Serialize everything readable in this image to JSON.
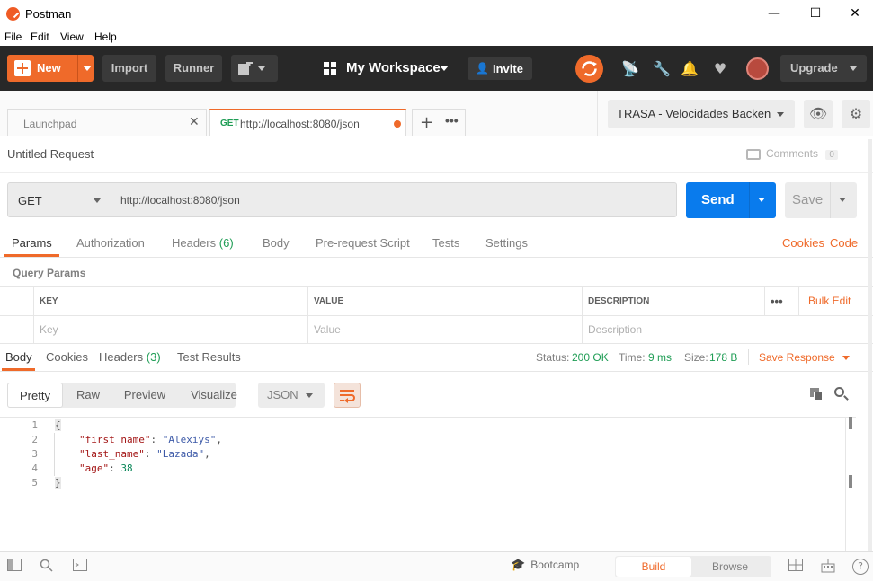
{
  "window": {
    "title": "Postman",
    "minimize": "—",
    "maximize": "☐",
    "close": "✕"
  },
  "menu": [
    "File",
    "Edit",
    "View",
    "Help"
  ],
  "header": {
    "new_label": "New",
    "import_label": "Import",
    "runner_label": "Runner",
    "workspace_label": "My Workspace",
    "invite_label": "Invite",
    "upgrade_label": "Upgrade",
    "accent_color": "#ef6a2a"
  },
  "tabs": [
    {
      "label": "Launchpad"
    },
    {
      "method": "GET",
      "label": "http://localhost:8080/json"
    }
  ],
  "environment": {
    "selected": "TRASA - Velocidades Backend"
  },
  "request": {
    "name": "Untitled Request",
    "comments_label": "Comments",
    "comments_count": "0",
    "method": "GET",
    "url": "http://localhost:8080/json",
    "send_label": "Send",
    "save_label": "Save"
  },
  "request_tabs": {
    "params": "Params",
    "authorization": "Authorization",
    "headers": "Headers",
    "headers_count": "(6)",
    "body": "Body",
    "prerequest": "Pre-request Script",
    "tests": "Tests",
    "settings": "Settings",
    "cookies": "Cookies",
    "code": "Code"
  },
  "query_params": {
    "title": "Query Params",
    "col_key": "KEY",
    "col_value": "VALUE",
    "col_desc": "DESCRIPTION",
    "bulk_edit": "Bulk Edit",
    "ph_key": "Key",
    "ph_value": "Value",
    "ph_desc": "Description"
  },
  "response_tabs": {
    "body": "Body",
    "cookies": "Cookies",
    "headers": "Headers",
    "headers_count": "(3)",
    "test_results": "Test Results"
  },
  "response_status": {
    "status_label": "Status:",
    "status_value": "200 OK",
    "time_label": "Time:",
    "time_value": "9 ms",
    "size_label": "Size:",
    "size_value": "178 B",
    "save_response": "Save Response"
  },
  "view_modes": [
    "Pretty",
    "Raw",
    "Preview",
    "Visualize"
  ],
  "format": "JSON",
  "code_lines": [
    {
      "n": "1",
      "open": "{"
    },
    {
      "n": "2",
      "key": "\"first_name\"",
      "sep": ": ",
      "val": "\"Alexiys\"",
      "end": ","
    },
    {
      "n": "3",
      "key": "\"last_name\"",
      "sep": ": ",
      "val": "\"Lazada\"",
      "end": ","
    },
    {
      "n": "4",
      "key": "\"age\"",
      "sep": ": ",
      "num": "38",
      "end": ""
    },
    {
      "n": "5",
      "close": "}"
    }
  ],
  "footer": {
    "bootcamp": "Bootcamp",
    "build": "Build",
    "browse": "Browse"
  }
}
